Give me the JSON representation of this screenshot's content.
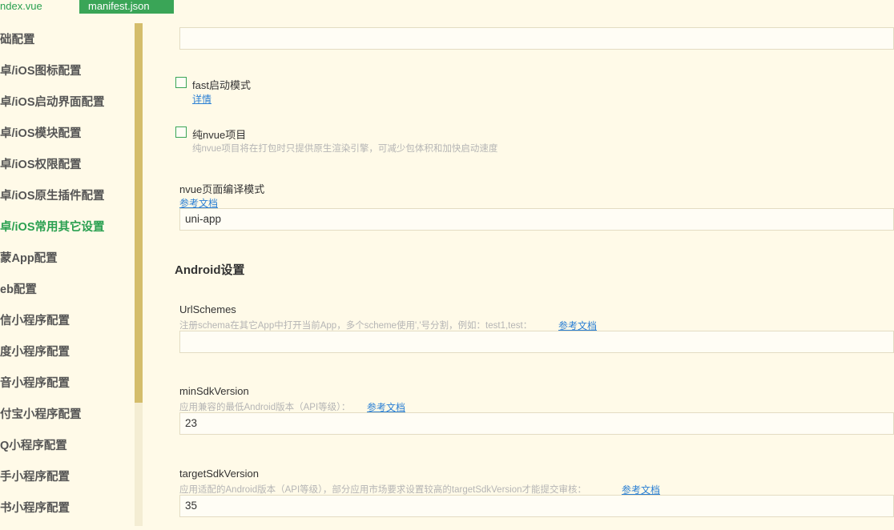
{
  "tabs": [
    {
      "label": "ndex.vue"
    },
    {
      "label": "manifest.json"
    }
  ],
  "sidebar": {
    "items": [
      {
        "label": "础配置"
      },
      {
        "label": "卓/iOS图标配置"
      },
      {
        "label": "卓/iOS启动界面配置"
      },
      {
        "label": "卓/iOS模块配置"
      },
      {
        "label": "卓/iOS权限配置"
      },
      {
        "label": "卓/iOS原生插件配置"
      },
      {
        "label": "卓/iOS常用其它设置"
      },
      {
        "label": "蒙App配置"
      },
      {
        "label": "eb配置"
      },
      {
        "label": "信小程序配置"
      },
      {
        "label": "度小程序配置"
      },
      {
        "label": "音小程序配置"
      },
      {
        "label": "付宝小程序配置"
      },
      {
        "label": "Q小程序配置"
      },
      {
        "label": "手小程序配置"
      },
      {
        "label": "书小程序配置"
      }
    ],
    "active_index": 6
  },
  "content": {
    "fast_start": {
      "label": "fast启动模式",
      "link": "详情"
    },
    "pure_nvue": {
      "label": "纯nvue项目",
      "desc": "纯nvue项目将在打包时只提供原生渲染引擎，可减少包体积和加快启动速度"
    },
    "nvue_mode": {
      "label": "nvue页面编译模式",
      "link": "参考文档",
      "value": "uni-app"
    },
    "android_section": {
      "title": "Android设置"
    },
    "url_schemes": {
      "label": "UrlSchemes",
      "desc": "注册schema在其它App中打开当前App，多个scheme使用','号分割，例如：test1,test：",
      "link": "参考文档",
      "value": ""
    },
    "min_sdk": {
      "label": "minSdkVersion",
      "desc": "应用兼容的最低Android版本（API等级）：",
      "link": "参考文档",
      "value": "23"
    },
    "target_sdk": {
      "label": "targetSdkVersion",
      "desc": "应用适配的Android版本（API等级），部分应用市场要求设置较高的targetSdkVersion才能提交审核：",
      "link": "参考文档",
      "value": "35"
    }
  },
  "colors": {
    "accent": "#3aa557",
    "background": "#fffae8",
    "link": "#2a7fd4",
    "scrollbar": "#d4bd6b"
  }
}
